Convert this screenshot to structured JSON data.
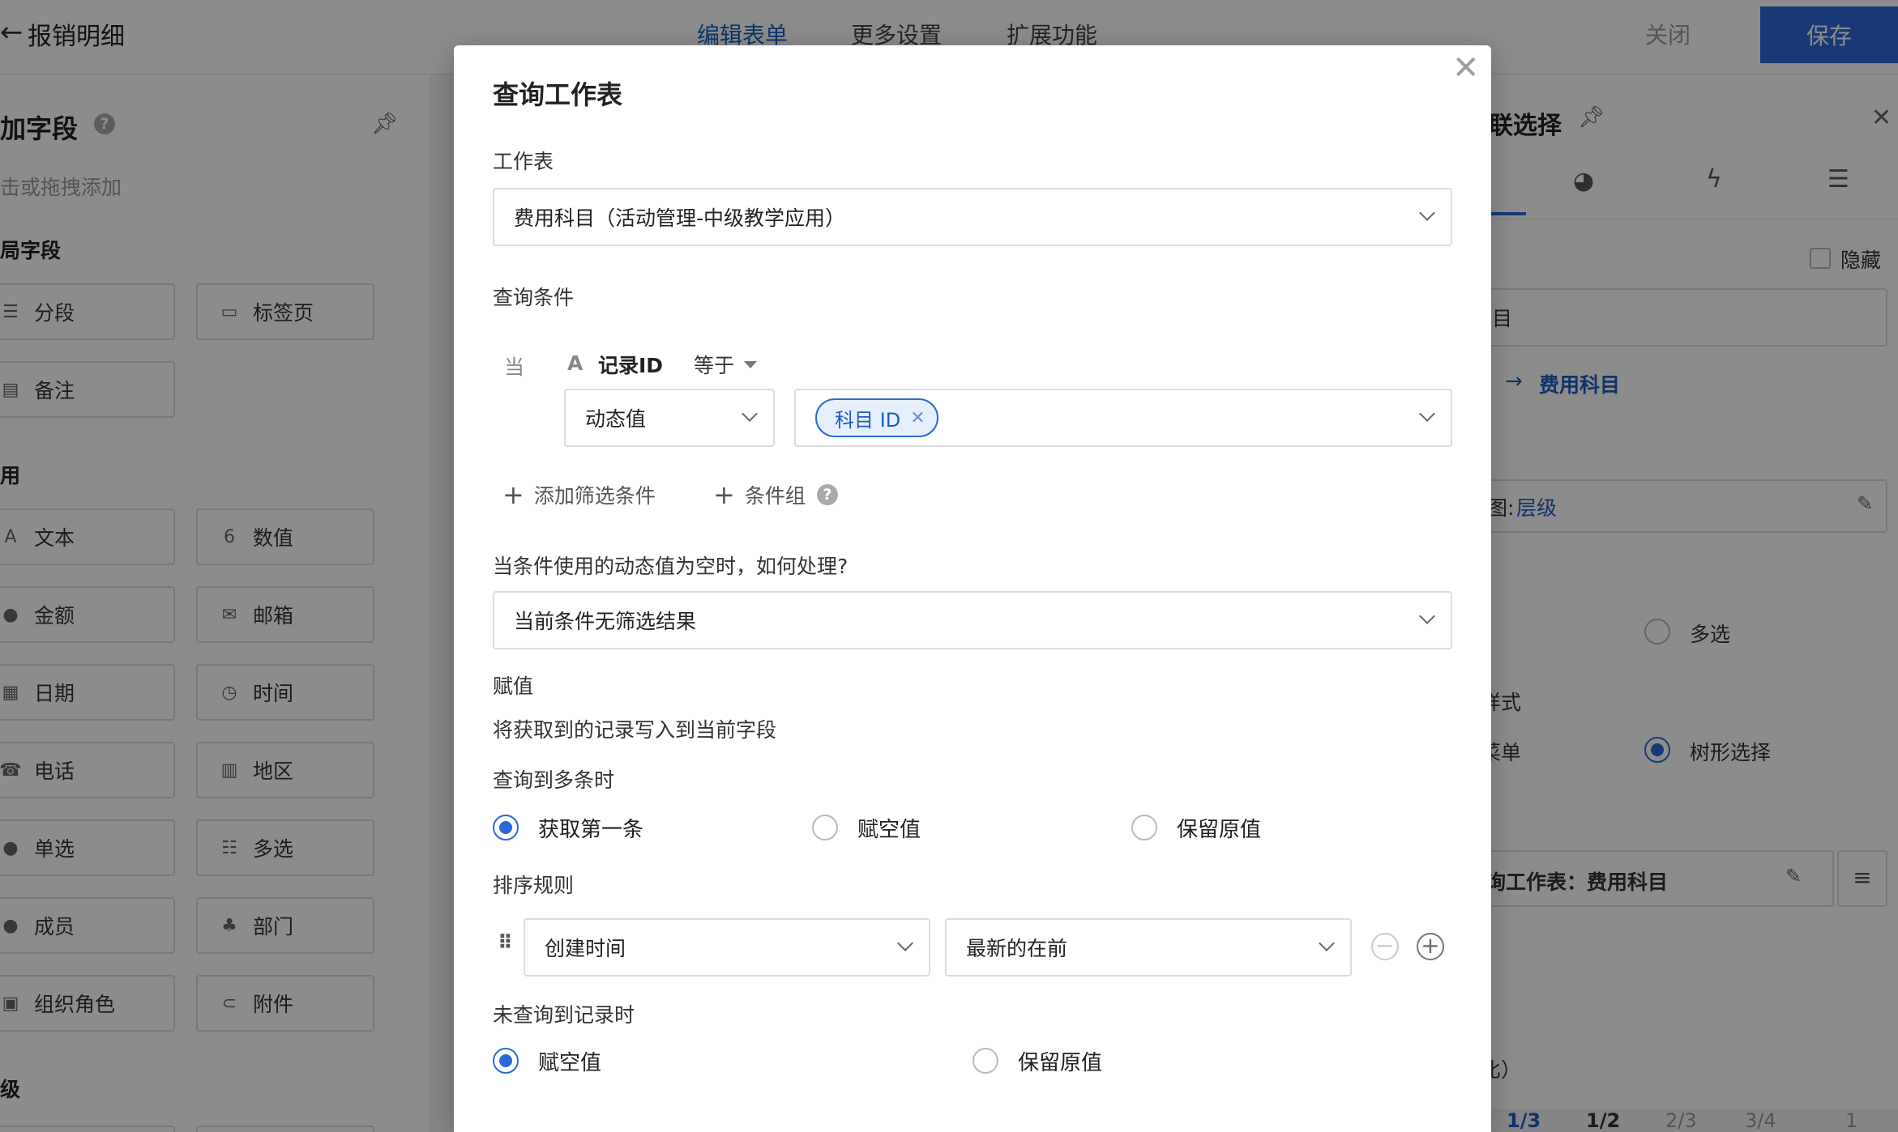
{
  "topbar": {
    "back": "←",
    "title": "报销明细",
    "tabs": [
      "编辑表单",
      "更多设置",
      "扩展功能"
    ],
    "close_label": "关闭",
    "save_label": "保存"
  },
  "left_panel": {
    "title": "加字段",
    "help": "?",
    "hint": "击或拖拽添加",
    "group_layout": "局字段",
    "group_common": "用",
    "group_advanced": "级",
    "fields": [
      {
        "icon": "☰",
        "label": "分段"
      },
      {
        "icon": "▭",
        "label": "标签页"
      },
      {
        "icon": "▤",
        "label": "备注"
      },
      {
        "icon": "A",
        "label": "文本"
      },
      {
        "icon": "6",
        "label": "数值"
      },
      {
        "icon": "●",
        "label": "金额"
      },
      {
        "icon": "✉",
        "label": "邮箱"
      },
      {
        "icon": "▦",
        "label": "日期"
      },
      {
        "icon": "◷",
        "label": "时间"
      },
      {
        "icon": "☎",
        "label": "电话"
      },
      {
        "icon": "▥",
        "label": "地区"
      },
      {
        "icon": "●",
        "label": "单选"
      },
      {
        "icon": "☷",
        "label": "多选"
      },
      {
        "icon": "●",
        "label": "成员"
      },
      {
        "icon": "♣",
        "label": "部门"
      },
      {
        "icon": "▣",
        "label": "组织角色"
      },
      {
        "icon": "⊂",
        "label": "附件"
      }
    ]
  },
  "right_panel": {
    "title": "联选择",
    "hide_label": "隐藏",
    "field_value": "目",
    "link_arrow": "→",
    "link_text": "费用科目",
    "view_prefix": "图:",
    "view_value": "层级",
    "multi_label": "多选",
    "style_label": "样式",
    "menu_label": "菜单",
    "tree_label": "树形选择",
    "query_label": "询工作表：费用科目",
    "ratio_label": "比）",
    "ratios": [
      "1/3",
      "1/2",
      "2/3",
      "3/4",
      "1"
    ]
  },
  "modal": {
    "title": "查询工作表",
    "worksheet_label": "工作表",
    "worksheet_value": "费用科目（活动管理-中级教学应用）",
    "conditions_label": "查询条件",
    "when_label": "当",
    "field_icon": "A",
    "field_name": "记录ID",
    "operator": "等于",
    "value_type": "动态值",
    "value_tag": "科目 ID",
    "add_filter": "添加筛选条件",
    "add_group": "条件组",
    "empty_question": "当条件使用的动态值为空时，如何处理?",
    "empty_value": "当前条件无筛选结果",
    "assign_label": "赋值",
    "assign_desc": "将获取到的记录写入到当前字段",
    "multi_label": "查询到多条时",
    "multi_options": [
      "获取第一条",
      "赋空值",
      "保留原值"
    ],
    "sort_label": "排序规则",
    "sort_field": "创建时间",
    "sort_order": "最新的在前",
    "notfound_label": "未查询到记录时",
    "notfound_options": [
      "赋空值",
      "保留原值"
    ]
  }
}
